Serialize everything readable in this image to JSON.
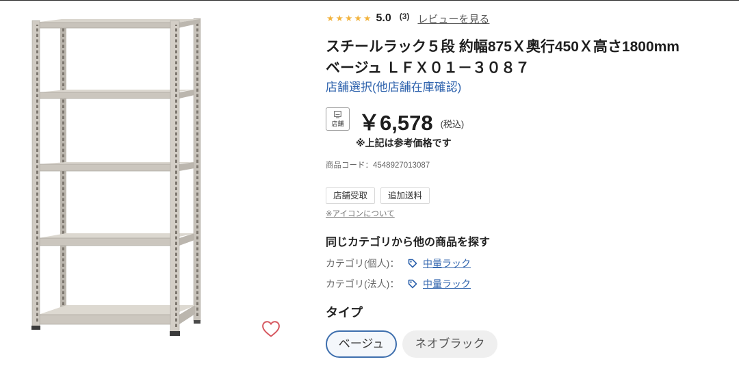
{
  "rating": {
    "stars_filled": 5,
    "stars_total": 5,
    "score": "5.0",
    "count": "(3)",
    "review_link": "レビューを見る"
  },
  "product": {
    "title_line1": "スチールラック５段 約幅875Ｘ奥行450Ｘ高さ1800mm",
    "title_line2": "ベージュ ＬＦＸ０１－３０８７",
    "store_select_link": "店舗選択(他店舗在庫確認)",
    "code": "商品コード：4548927013087"
  },
  "price": {
    "badge_label": "店舗",
    "amount": "￥6,578",
    "tax_label": "(税込)",
    "note": "※上記は参考価格です"
  },
  "service_tags": [
    "店舗受取",
    "追加送料"
  ],
  "icon_help_link": "※アイコンについて",
  "category_search": {
    "heading": "同じカテゴリから他の商品を探す",
    "rows": [
      {
        "label": "カテゴリ(個人)：",
        "link": "中量ラック"
      },
      {
        "label": "カテゴリ(法人)：",
        "link": "中量ラック"
      }
    ]
  },
  "type_selector": {
    "heading": "タイプ",
    "options": [
      {
        "label": "ベージュ",
        "selected": true
      },
      {
        "label": "ネオブラック",
        "selected": false
      }
    ]
  },
  "icons": {
    "rating": "star-icon",
    "price_badge": "store-icon",
    "category": "tag-icon",
    "favorite": "heart-icon"
  },
  "colors": {
    "star": "#f2b33d",
    "link": "#2f63ad",
    "heart": "#d6575f",
    "selected_border": "#3d6ead"
  }
}
